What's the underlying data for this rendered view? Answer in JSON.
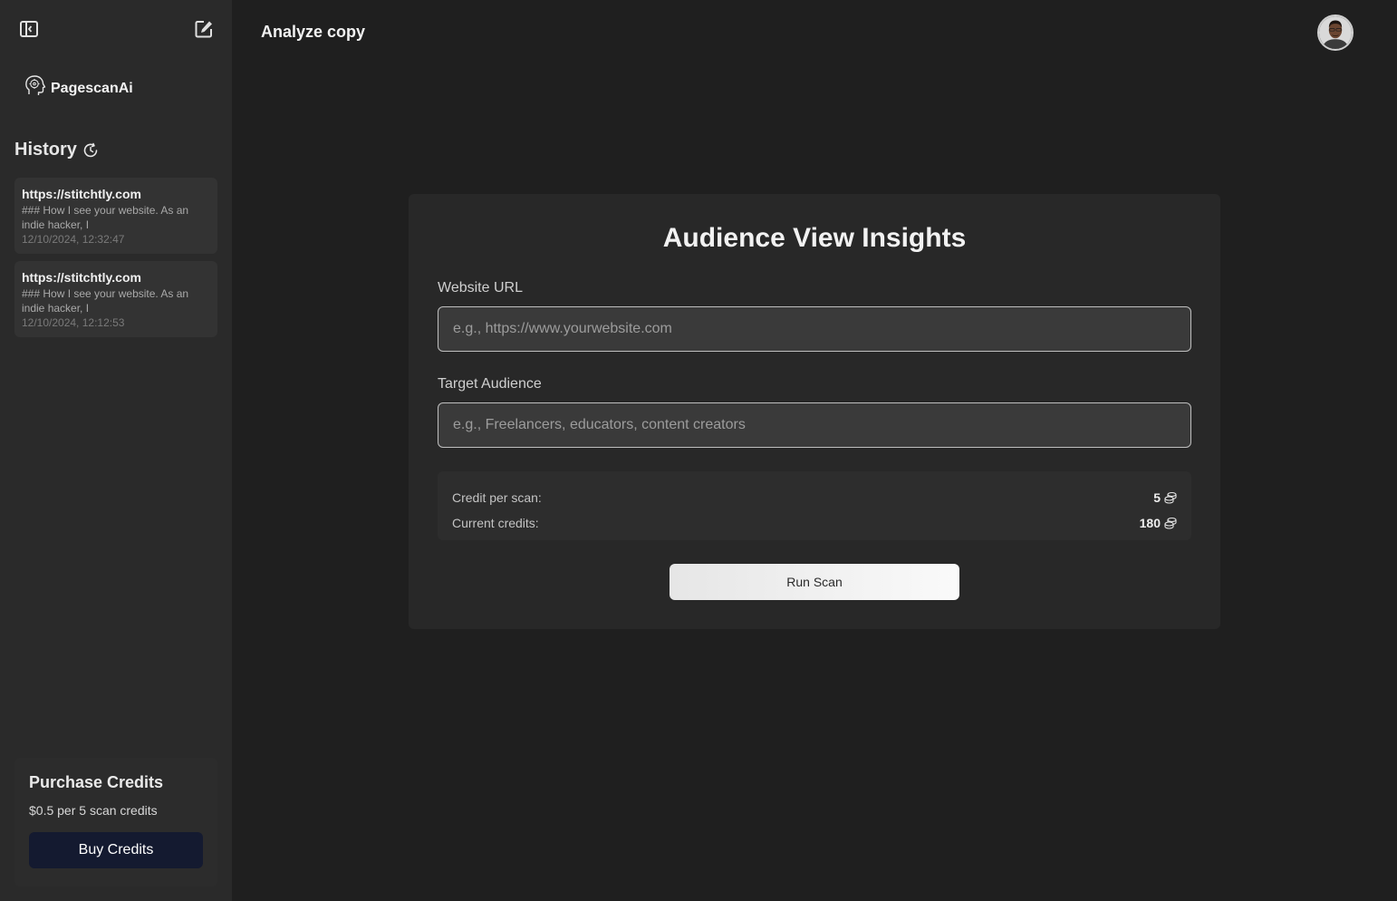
{
  "app": {
    "brand_name": "PagescanAi",
    "page_title": "Analyze copy"
  },
  "sidebar": {
    "history_title": "History",
    "history": [
      {
        "url": "https://stitchtly.com",
        "snippet": "### How I see your website. As an indie hacker, I",
        "date": "12/10/2024, 12:32:47"
      },
      {
        "url": "https://stitchtly.com",
        "snippet": "### How I see your website. As an indie hacker, I",
        "date": "12/10/2024, 12:12:53"
      }
    ],
    "purchase": {
      "title": "Purchase Credits",
      "description": "$0.5 per 5 scan credits",
      "button_label": "Buy Credits"
    }
  },
  "form": {
    "title": "Audience View Insights",
    "website_url_label": "Website URL",
    "website_url_placeholder": "e.g., https://www.yourwebsite.com",
    "website_url_value": "",
    "audience_label": "Target Audience",
    "audience_placeholder": "e.g., Freelancers, educators, content creators",
    "audience_value": "",
    "credit_per_scan_label": "Credit per scan:",
    "credit_per_scan_value": "5",
    "current_credits_label": "Current credits:",
    "current_credits_value": "180",
    "run_button_label": "Run Scan"
  },
  "colors": {
    "sidebar_bg": "#2a2a2a",
    "main_bg": "#1f1f1f",
    "card_bg": "#282828",
    "buy_button_bg": "#141a30"
  },
  "icons": {
    "sidebar_toggle": "panel-left-icon",
    "new_chat": "edit-square-icon",
    "brand": "brain-head-icon",
    "history": "history-clock-icon",
    "coins": "coins-icon"
  }
}
